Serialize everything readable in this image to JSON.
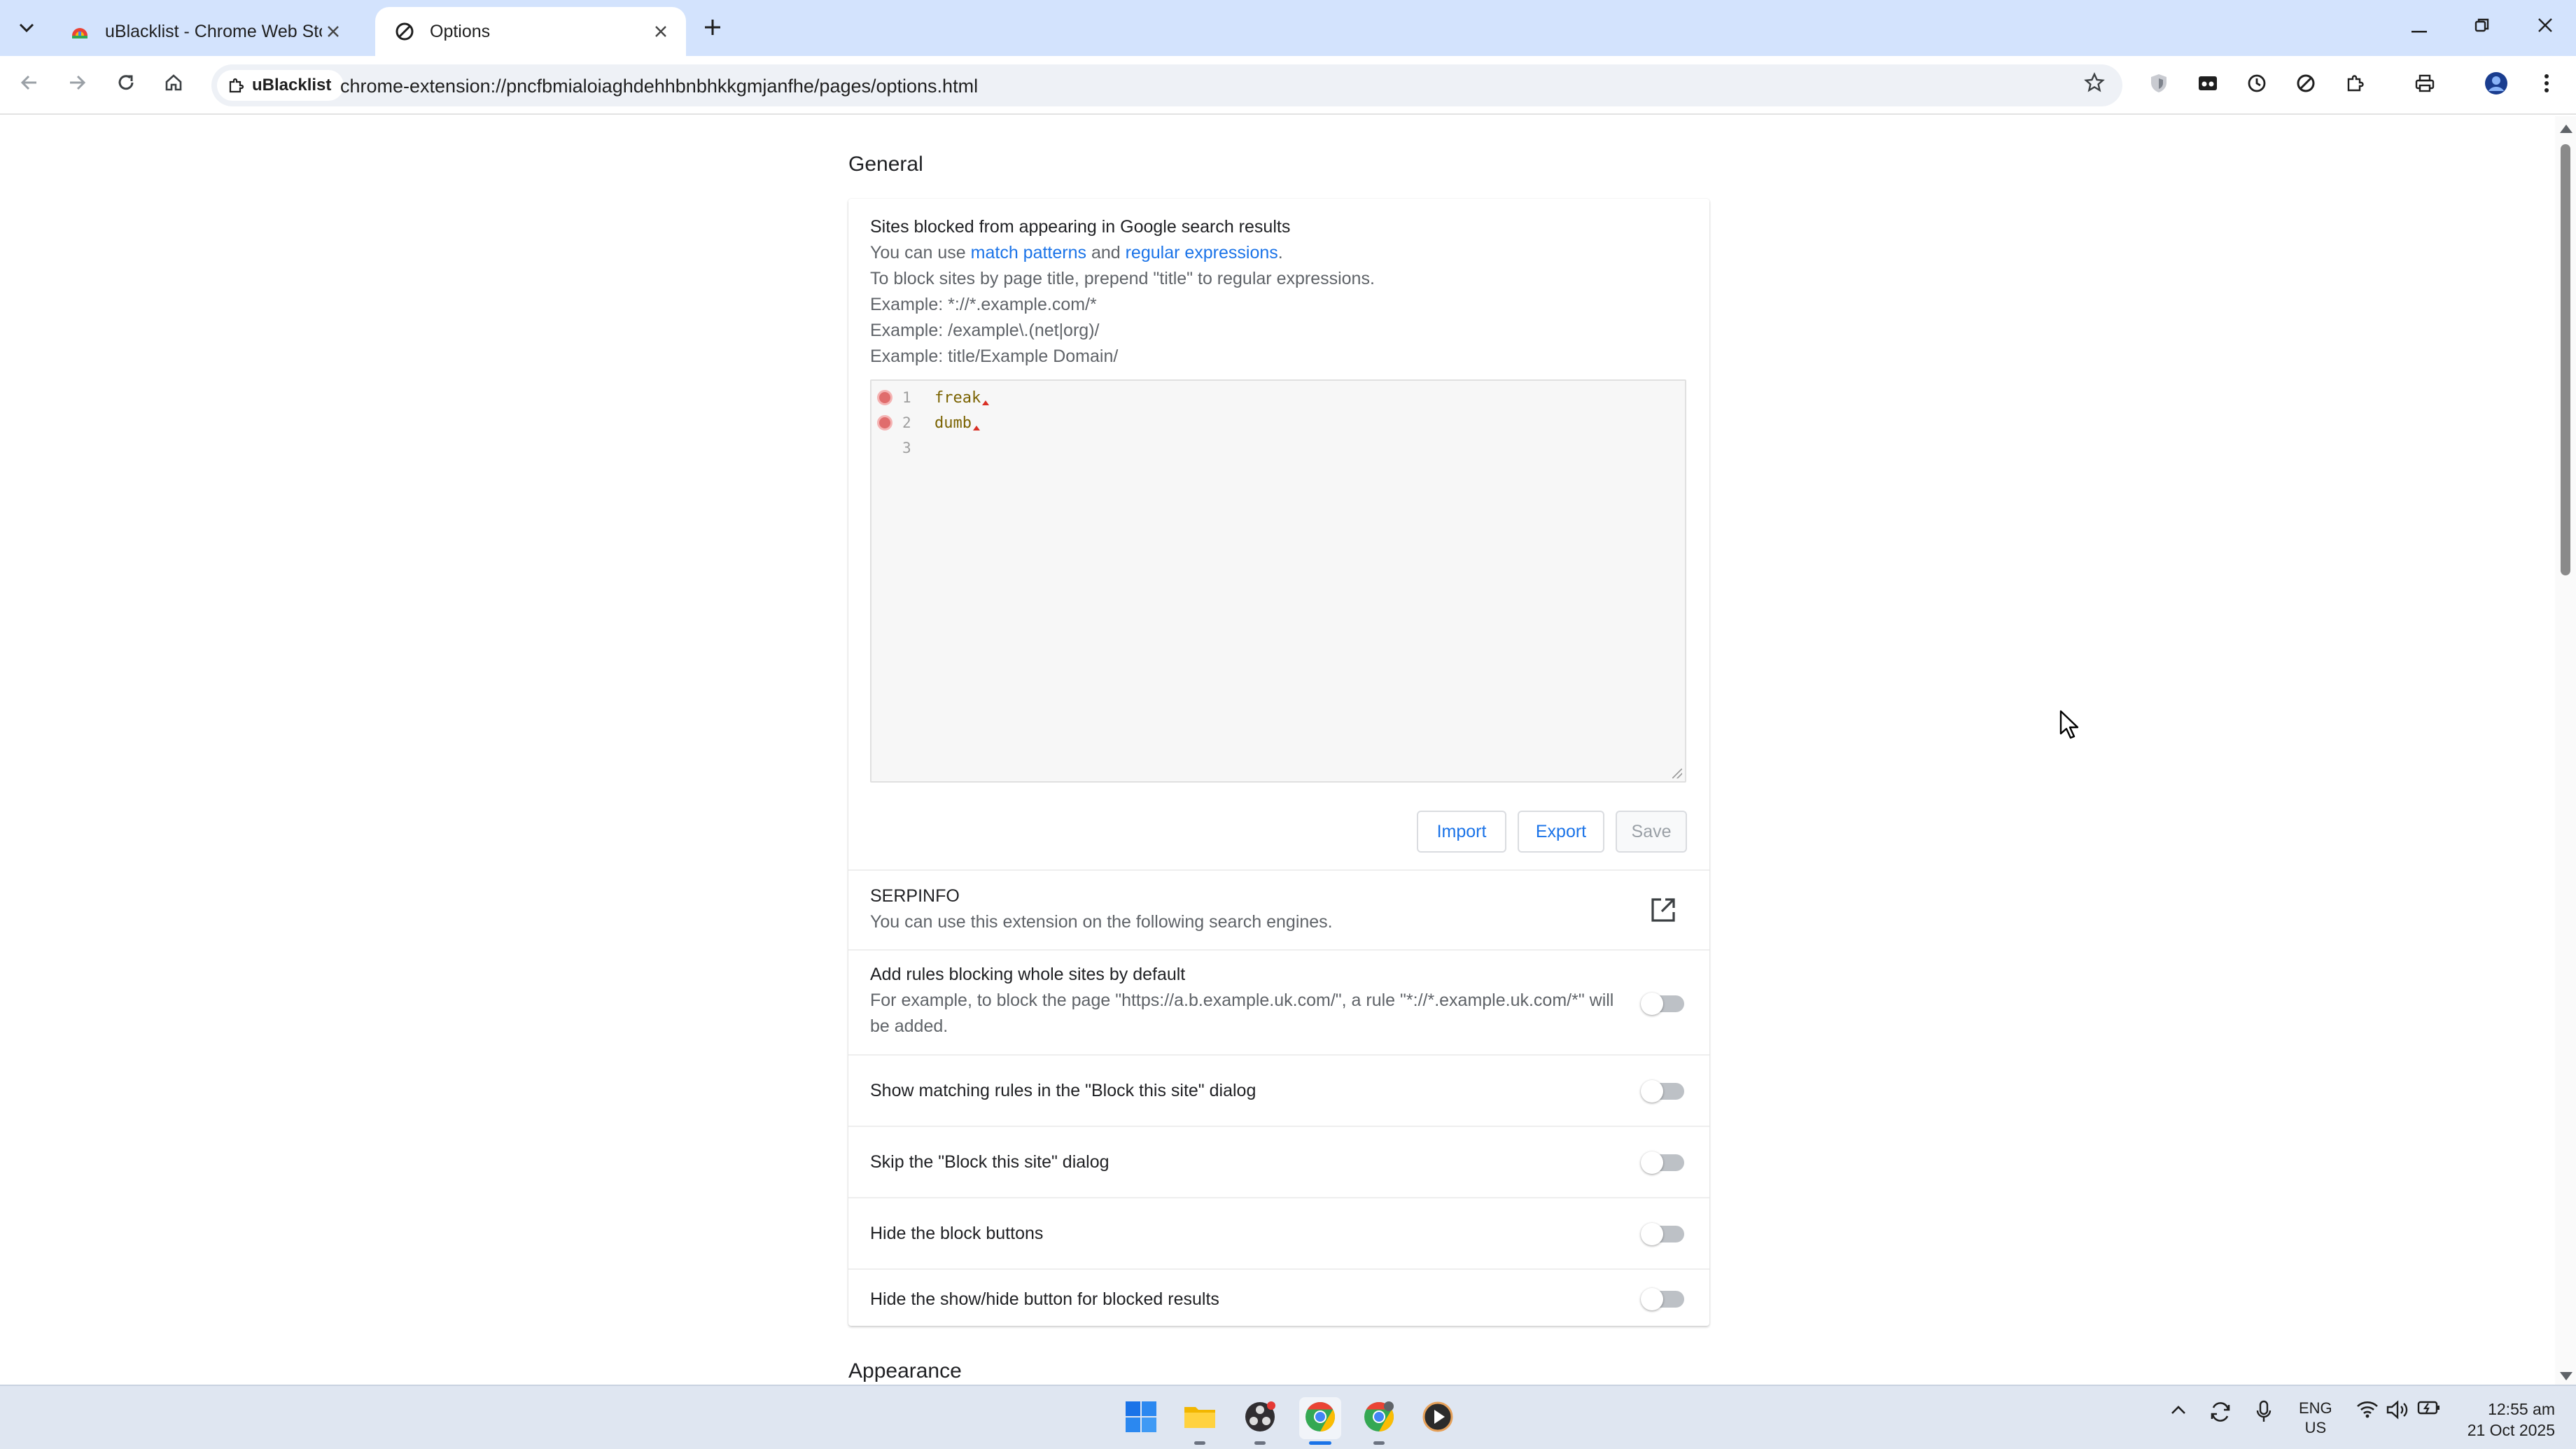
{
  "browser": {
    "tabs": [
      {
        "title": "uBlacklist - Chrome Web Store",
        "active": false,
        "favicon": "chrome-web-store-icon"
      },
      {
        "title": "Options",
        "active": true,
        "favicon": "ublacklist-icon"
      }
    ],
    "site_chip": "uBlacklist",
    "url": "chrome-extension://pncfbmialoiaghdehhbnbhkkgmjanfhe/pages/options.html"
  },
  "page": {
    "general_heading": "General",
    "blocked": {
      "title": "Sites blocked from appearing in Google search results",
      "help_prefix": "You can use ",
      "help_link1": "match patterns",
      "help_and": " and ",
      "help_link2": "regular expressions",
      "help_suffix": ".",
      "title_hint": "To block sites by page title, prepend \"title\" to regular expressions.",
      "example1": "Example: *://*.example.com/*",
      "example2": "Example: /example\\.(net|org)/",
      "example3": "Example: title/Example Domain/"
    },
    "editor": {
      "lines": [
        {
          "number": "1",
          "text": "freak",
          "error": true
        },
        {
          "number": "2",
          "text": "dumb",
          "error": true
        },
        {
          "number": "3",
          "text": "",
          "error": false
        }
      ]
    },
    "buttons": {
      "import": "Import",
      "export": "Export",
      "save": "Save"
    },
    "serpinfo": {
      "title": "SERPINFO",
      "desc": "You can use this extension on the following search engines."
    },
    "settings": [
      {
        "title": "Add rules blocking whole sites by default",
        "desc": "For example, to block the page \"https://a.b.example.uk.com/\", a rule \"*://*.example.uk.com/*\" will be added.",
        "enabled": false
      },
      {
        "title": "Show matching rules in the \"Block this site\" dialog",
        "enabled": false
      },
      {
        "title": "Skip the \"Block this site\" dialog",
        "enabled": false
      },
      {
        "title": "Hide the block buttons",
        "enabled": false
      },
      {
        "title": "Hide the show/hide button for blocked results",
        "enabled": false
      }
    ],
    "appearance_heading": "Appearance"
  },
  "taskbar": {
    "lang_top": "ENG",
    "lang_bottom": "US",
    "time": "12:55 am",
    "date": "21 Oct 2025"
  },
  "colors": {
    "accent": "#1a73e8",
    "tabstrip": "#d3e3fd",
    "error": "#e06c6c"
  }
}
